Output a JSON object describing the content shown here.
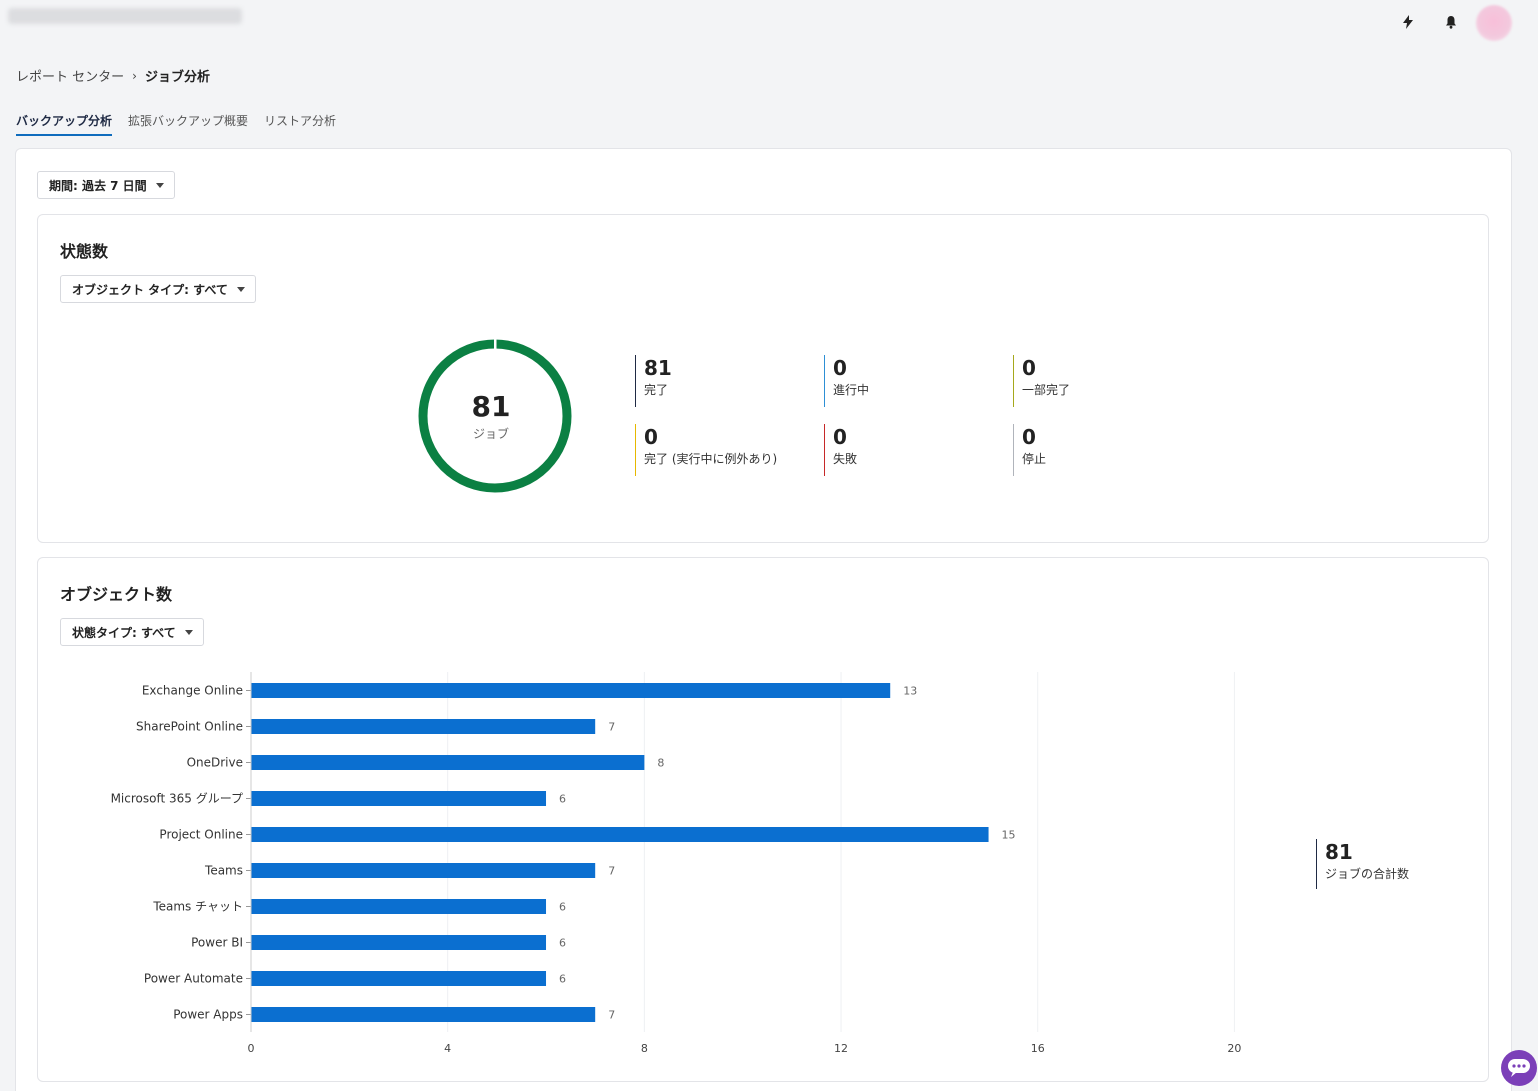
{
  "header": {
    "bolt_icon": "bolt-icon",
    "bell_icon": "bell-icon"
  },
  "breadcrumb": {
    "root": "レポート センター",
    "separator": "›",
    "current": "ジョブ分析"
  },
  "tabs": [
    {
      "label": "バックアップ分析",
      "active": true
    },
    {
      "label": "拡張バックアップ概要",
      "active": false
    },
    {
      "label": "リストア分析",
      "active": false
    }
  ],
  "period_filter": "期間: 過去 7 日間",
  "status_panel": {
    "title": "状態数",
    "filter": "オブジェクト タイプ: すべて",
    "donut": {
      "total": "81",
      "label": "ジョブ",
      "color": "#0b8043"
    },
    "stats": [
      {
        "value": "81",
        "label": "完了",
        "color": "#1f2a44"
      },
      {
        "value": "0",
        "label": "進行中",
        "color": "#2d8fd5"
      },
      {
        "value": "0",
        "label": "一部完了",
        "color": "#a6a81c"
      },
      {
        "value": "0",
        "label": "完了 (実行中に例外あり)",
        "color": "#e6b800"
      },
      {
        "value": "0",
        "label": "失敗",
        "color": "#c62828"
      },
      {
        "value": "0",
        "label": "停止",
        "color": "#b0b4bb"
      }
    ]
  },
  "object_panel": {
    "title": "オブジェクト数",
    "filter": "状態タイプ: すべて",
    "total": {
      "value": "81",
      "label": "ジョブの合計数"
    }
  },
  "chart_data": {
    "type": "bar",
    "orientation": "horizontal",
    "categories": [
      "Exchange Online",
      "SharePoint Online",
      "OneDrive",
      "Microsoft 365 グループ",
      "Project Online",
      "Teams",
      "Teams チャット",
      "Power BI",
      "Power Automate",
      "Power Apps"
    ],
    "values": [
      13,
      7,
      8,
      6,
      15,
      7,
      6,
      6,
      6,
      7
    ],
    "xticks": [
      0,
      4,
      8,
      12,
      16,
      20
    ],
    "xlim": [
      0,
      24
    ],
    "bar_color": "#0b6fd0",
    "grid": true,
    "data_labels": true
  }
}
